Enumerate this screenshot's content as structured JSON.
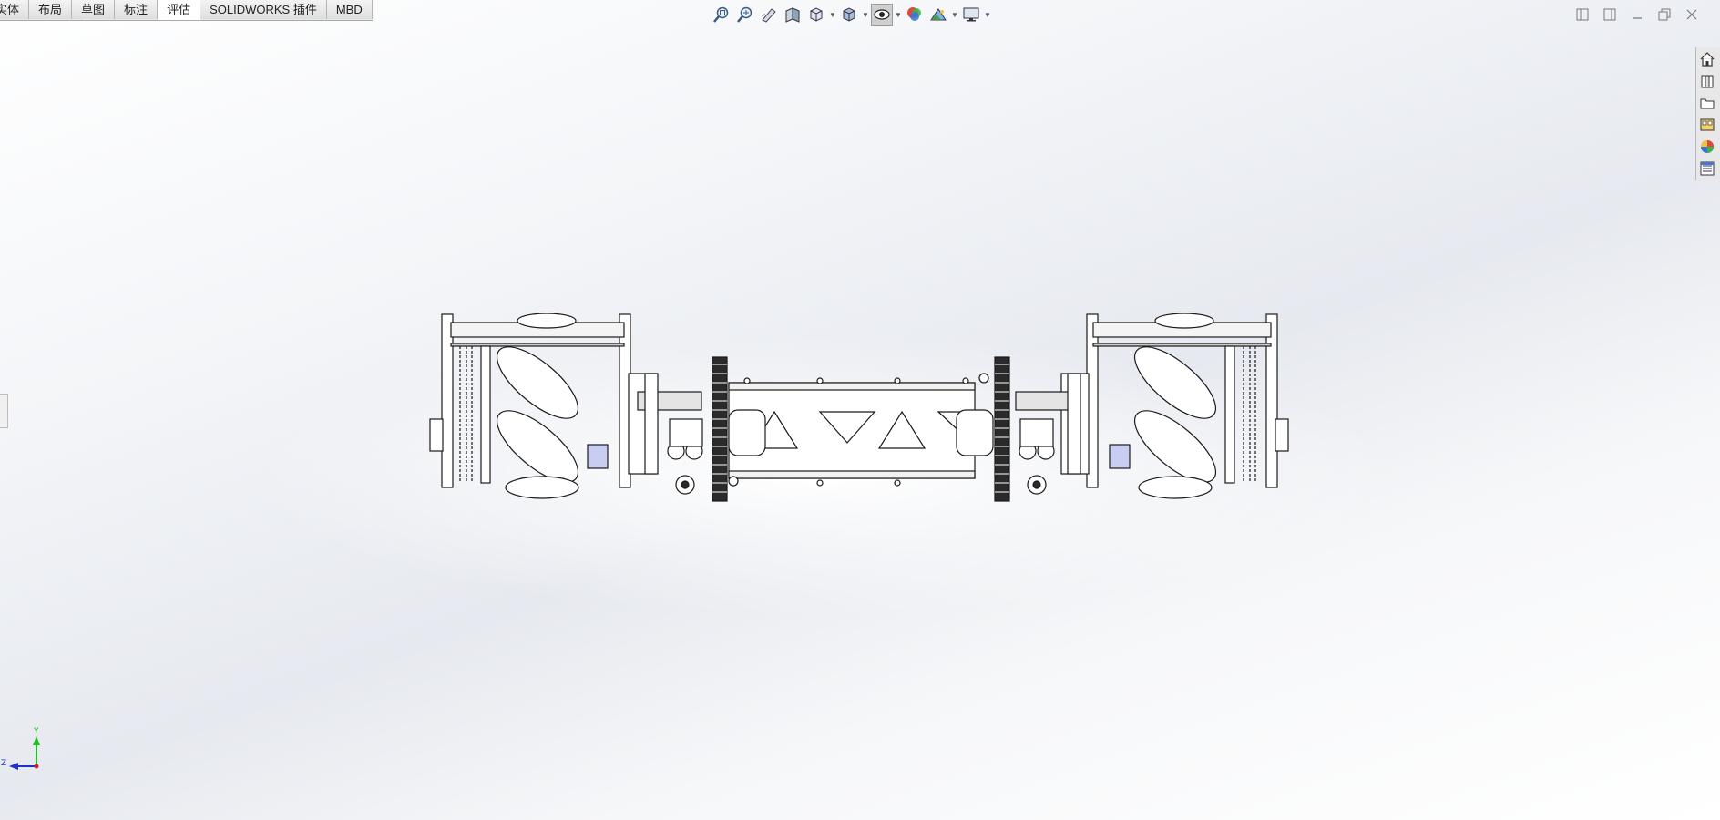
{
  "tabs": [
    {
      "label": "实体",
      "active": false
    },
    {
      "label": "布局",
      "active": false
    },
    {
      "label": "草图",
      "active": false
    },
    {
      "label": "标注",
      "active": false
    },
    {
      "label": "评估",
      "active": true
    },
    {
      "label": "SOLIDWORKS 插件",
      "active": false
    },
    {
      "label": "MBD",
      "active": false
    }
  ],
  "hud_icons": [
    "zoom-to-fit-icon",
    "zoom-area-icon",
    "previous-view-icon",
    "section-view-icon",
    "view-orientation-icon",
    "display-style-icon",
    "hide-show-items-icon",
    "edit-appearance-icon",
    "apply-scene-icon",
    "view-settings-icon"
  ],
  "task_pane_icons": [
    "solidworks-resources-icon",
    "design-library-icon",
    "file-explorer-icon",
    "view-palette-icon",
    "appearances-scenes-icon",
    "custom-properties-icon"
  ],
  "triad": {
    "y_label": "Y",
    "z_label": "Z",
    "y_color": "#1fbf1f",
    "z_color": "#1f2fd0",
    "x_color": "#d01f1f"
  },
  "colors": {
    "active_tab": "#ffffff",
    "tab_bar": "#e9e9e9",
    "model_line": "#1a1a1a",
    "highlight_blue": "#c9cdf2"
  }
}
